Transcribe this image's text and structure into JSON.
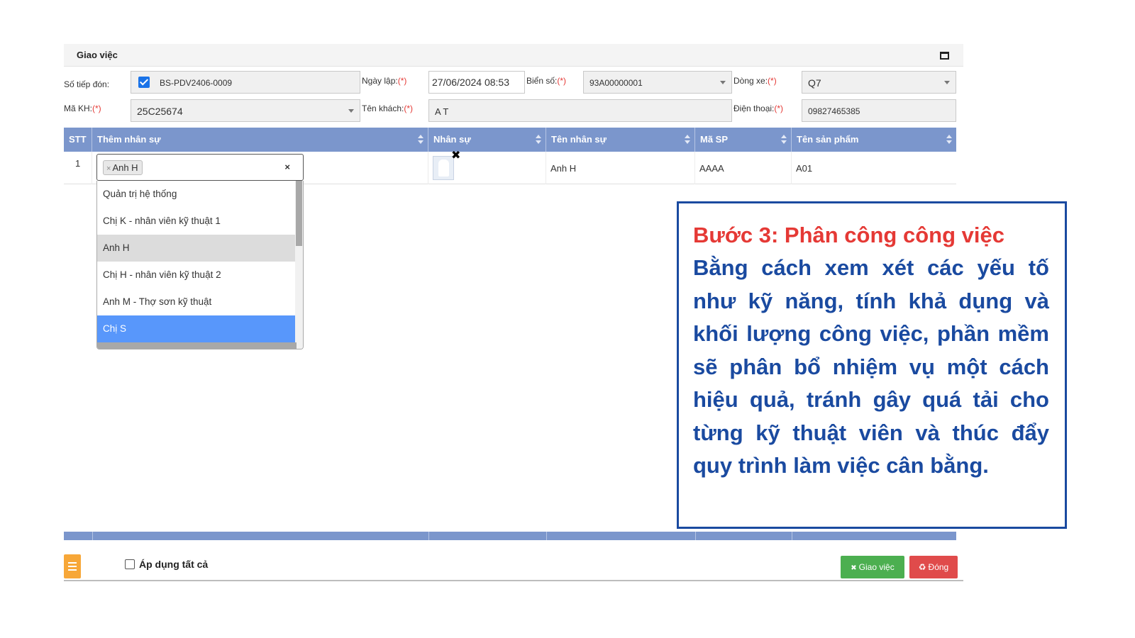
{
  "window": {
    "title": "Giao việc"
  },
  "form": {
    "so_tiep_don": {
      "label": "Số tiếp đón:",
      "value": "BS-PDV2406-0009"
    },
    "ngay_lap": {
      "label": "Ngày lập:",
      "req": "(*)",
      "value": "27/06/2024 08:53"
    },
    "bien_so": {
      "label": "Biển số:",
      "req": "(*)",
      "value": "93A00000001"
    },
    "dong_xe": {
      "label": "Dòng xe:",
      "req": "(*)",
      "value": "Q7"
    },
    "ma_kh": {
      "label": "Mã KH:",
      "req": "(*)",
      "value": "25C25674"
    },
    "ten_khach": {
      "label": "Tên khách:",
      "req": "(*)",
      "value": "A T"
    },
    "dien_thoai": {
      "label": "Điện thoại:",
      "req": "(*)",
      "value": "09827465385"
    }
  },
  "table": {
    "headers": [
      "STT",
      "Thêm nhân sự",
      "Nhân sự",
      "Tên nhân sự",
      "Mã SP",
      "Tên sản phẩm"
    ],
    "row": {
      "stt": "1",
      "tag": "Anh H",
      "tag_x": "×",
      "ten_nhan_su": "Anh H",
      "ma_sp": "AAAA",
      "ten_san_pham": "A01"
    },
    "clear": "×",
    "avatar_remove": "✖"
  },
  "dropdown": {
    "options": [
      "Quản trị hệ thống",
      "Chị K - nhân viên kỹ thuật 1",
      "Anh H",
      "Chị H - nhân viên kỹ thuật 2",
      "Anh M - Thợ sơn kỹ thuật",
      "Chị S"
    ]
  },
  "bottom": {
    "apply_all": "Áp dụng tất cả",
    "assign_button": "Giao việc",
    "close_button": "Đóng",
    "assign_icon": "✖",
    "close_icon": "♻"
  },
  "callout": {
    "heading": "Bước 3: Phân công công việc",
    "body": "Bằng cách xem xét các yếu tố như kỹ năng, tính khả dụng và khối lượng công việc, phần mềm sẽ phân bổ nhiệm vụ một cách hiệu quả, tránh gây quá tải cho từng kỹ thuật viên và thúc đẩy quy trình làm việc cân bằng."
  },
  "colors": {
    "table_header": "#7b96cc",
    "selected_option": "#5897fb",
    "assign_button": "#4caf50",
    "close_button": "#e04b4b",
    "callout_heading": "#e53935",
    "callout_text": "#1a4aa0",
    "menu_button": "#f7a738"
  },
  "icons": [
    "maximize-icon",
    "checkbox-checked-icon",
    "chevron-down-icon",
    "avatar-icon",
    "close-icon",
    "menu-icon",
    "recycle-icon"
  ]
}
